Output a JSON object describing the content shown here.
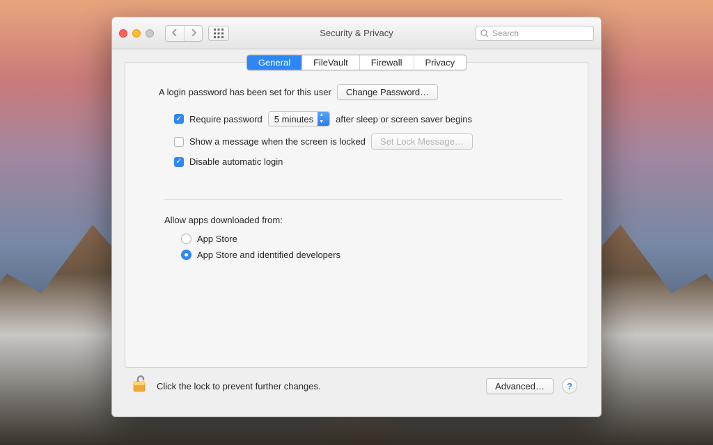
{
  "window": {
    "title": "Security & Privacy"
  },
  "search": {
    "placeholder": "Search"
  },
  "tabs": {
    "general": "General",
    "filevault": "FileVault",
    "firewall": "Firewall",
    "privacy": "Privacy"
  },
  "login": {
    "text": "A login password has been set for this user",
    "change_button": "Change Password…"
  },
  "require_password": {
    "label_before": "Require password",
    "delay_value": "5 minutes",
    "label_after": "after sleep or screen saver begins"
  },
  "show_message": {
    "label": "Show a message when the screen is locked",
    "button": "Set Lock Message…"
  },
  "disable_auto_login": {
    "label": "Disable automatic login"
  },
  "allow_apps": {
    "label": "Allow apps downloaded from:",
    "option_appstore": "App Store",
    "option_identified": "App Store and identified developers"
  },
  "footer": {
    "lock_text": "Click the lock to prevent further changes.",
    "advanced": "Advanced…",
    "help": "?"
  }
}
